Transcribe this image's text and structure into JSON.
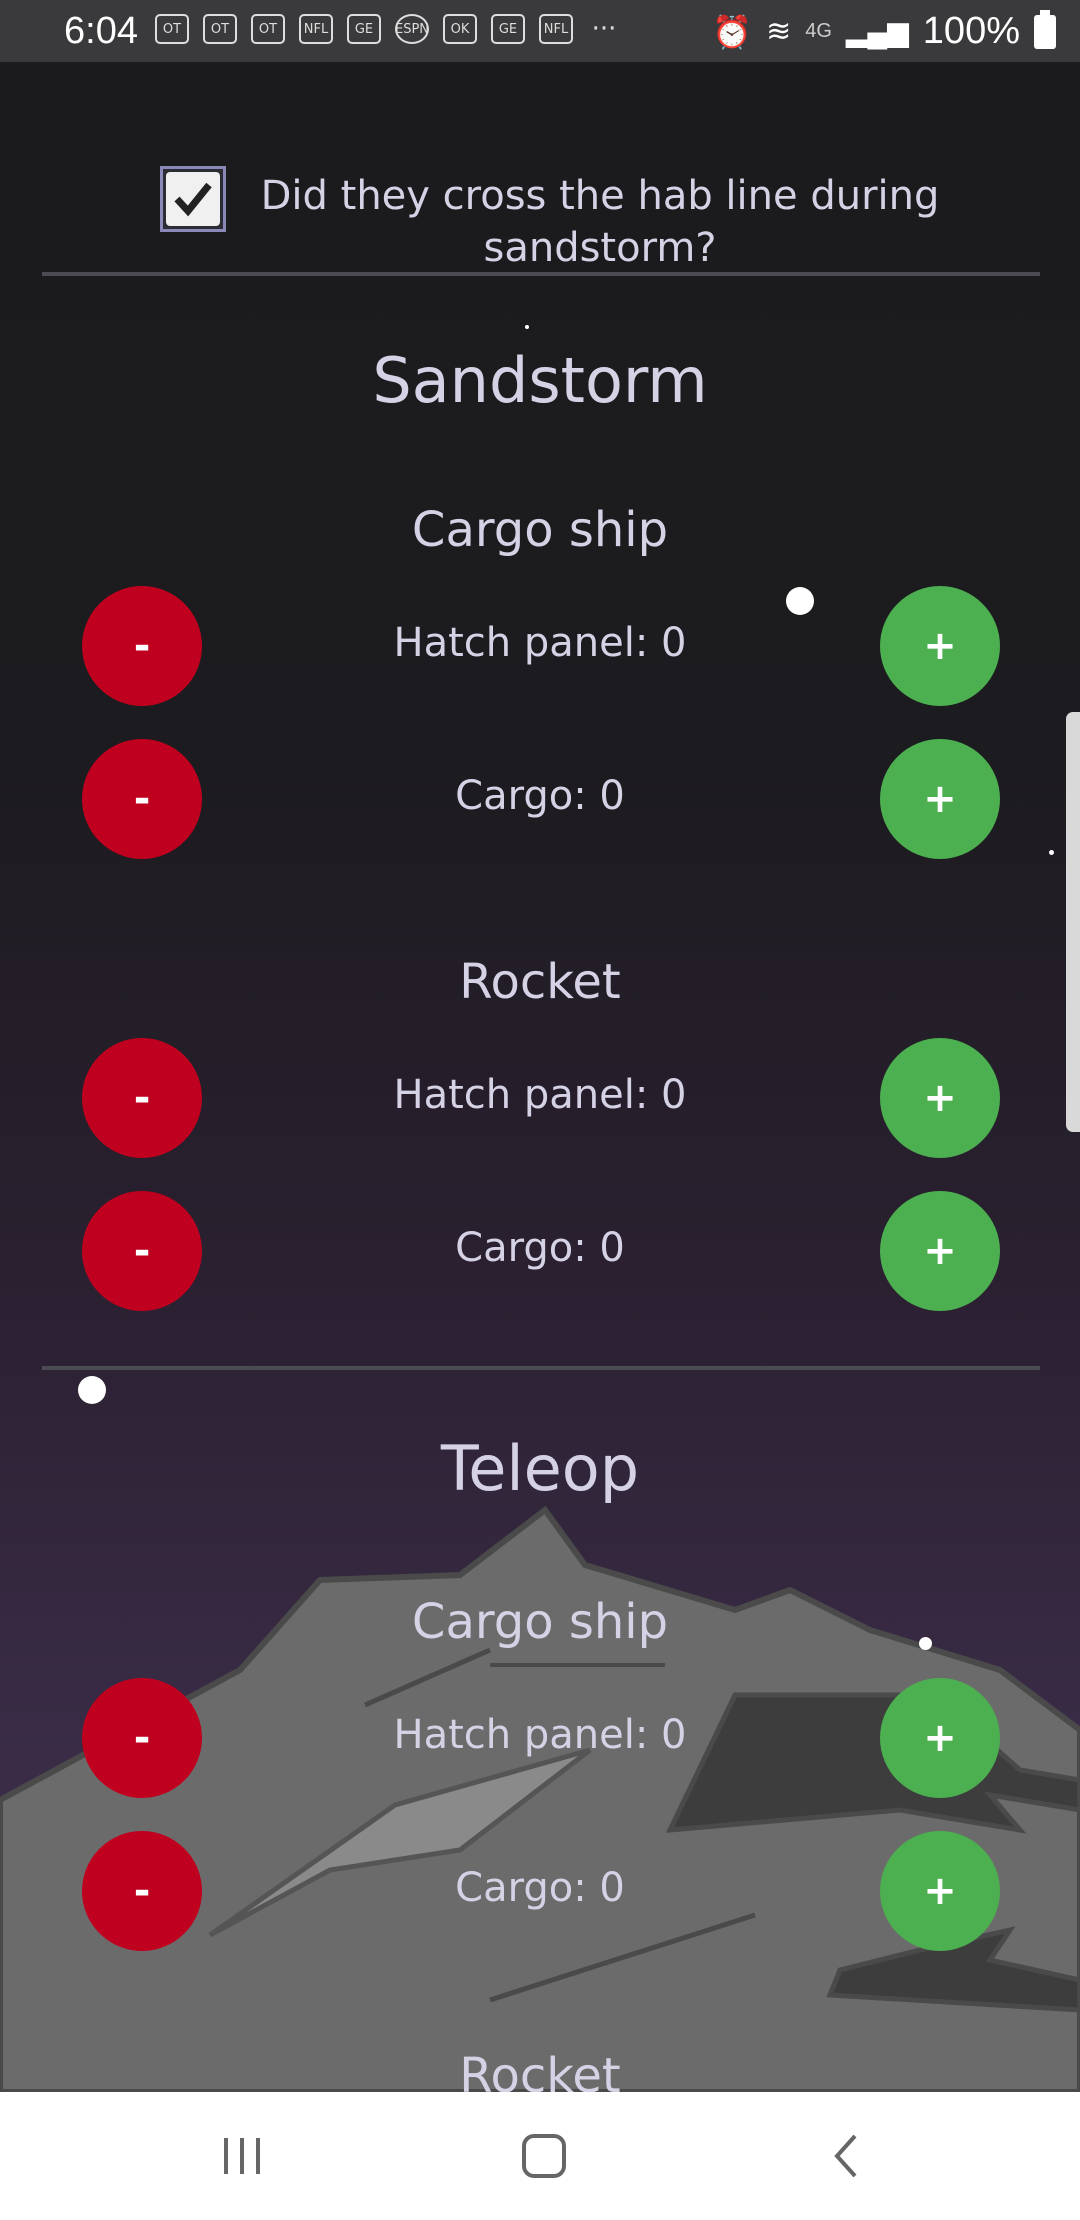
{
  "status_bar": {
    "time": "6:04",
    "notification_icons": [
      "OT",
      "OT",
      "OT",
      "NFL",
      "GE",
      "ESPN",
      "OK",
      "GE",
      "NFL"
    ],
    "more": "···",
    "network": "4G",
    "battery": "100%"
  },
  "checkbox": {
    "checked": true,
    "label": "Did they cross the hab line during sandstorm?"
  },
  "sandstorm": {
    "title": "Sandstorm",
    "cargo_ship": {
      "title": "Cargo ship",
      "hatch_panel": "Hatch panel: 0",
      "cargo": "Cargo: 0"
    },
    "rocket": {
      "title": "Rocket",
      "hatch_panel": "Hatch panel: 0",
      "cargo": "Cargo: 0"
    }
  },
  "teleop": {
    "title": "Teleop",
    "cargo_ship": {
      "title": "Cargo ship",
      "hatch_panel": "Hatch panel: 0",
      "cargo": "Cargo: 0"
    },
    "rocket": {
      "title": "Rocket"
    }
  },
  "buttons": {
    "minus": "-",
    "plus": "+"
  },
  "colors": {
    "minus_button": "#c0001f",
    "plus_button": "#4caf50",
    "text": "#d6d2e6",
    "background": "#1a1a1c"
  }
}
